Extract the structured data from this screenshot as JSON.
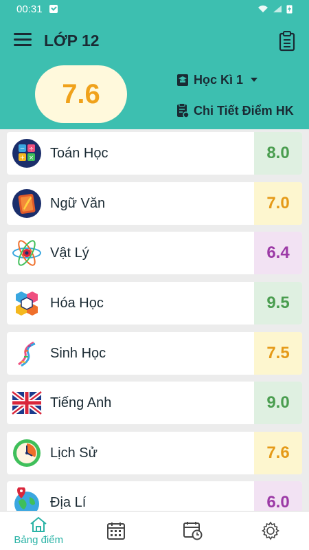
{
  "status": {
    "time": "00:31"
  },
  "header": {
    "title": "LỚP 12",
    "gpa": "7.6",
    "semester": "Học Kì 1",
    "detail_label": "Chi Tiết Điểm HK"
  },
  "subjects": [
    {
      "name": "Toán Học",
      "score": "8.0",
      "icon": "math-icon",
      "bg": "#dff0e1",
      "color": "#4a9d4f"
    },
    {
      "name": "Ngữ Văn",
      "score": "7.0",
      "icon": "literature-icon",
      "bg": "#fdf6cf",
      "color": "#e59a18"
    },
    {
      "name": "Vật Lý",
      "score": "6.4",
      "icon": "physics-atom-icon",
      "bg": "#f2e2f3",
      "color": "#9c3aa6"
    },
    {
      "name": "Hóa Học",
      "score": "9.5",
      "icon": "chemistry-hexagon-icon",
      "bg": "#dff0e1",
      "color": "#4a9d4f"
    },
    {
      "name": "Sinh Học",
      "score": "7.5",
      "icon": "dna-icon",
      "bg": "#fdf6cf",
      "color": "#e59a18"
    },
    {
      "name": "Tiếng Anh",
      "score": "9.0",
      "icon": "uk-flag-icon",
      "bg": "#dff0e1",
      "color": "#4a9d4f"
    },
    {
      "name": "Lịch Sử",
      "score": "7.6",
      "icon": "history-clock-icon",
      "bg": "#fdf6cf",
      "color": "#e59a18"
    },
    {
      "name": "Địa Lí",
      "score": "6.0",
      "icon": "geography-globe-icon",
      "bg": "#f2e2f3",
      "color": "#9c3aa6"
    }
  ],
  "nav": {
    "home_label": "Bảng điểm"
  },
  "colors": {
    "teal": "#3dbfb0",
    "gpa": "#f0a21b",
    "active": "#2ab3a6"
  }
}
